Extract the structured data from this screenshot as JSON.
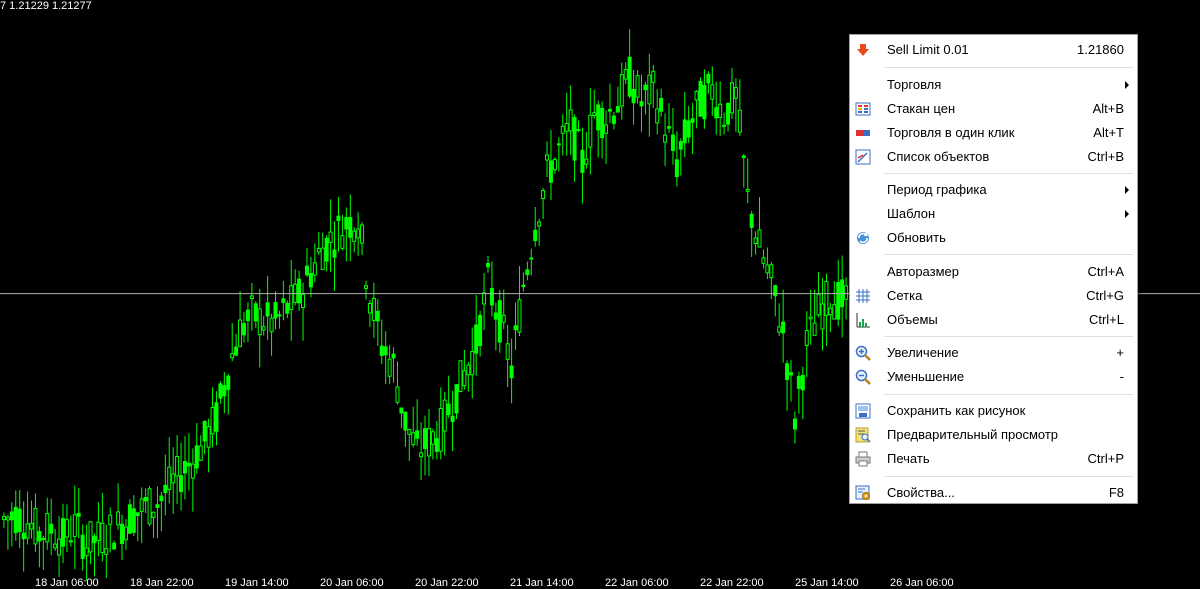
{
  "chart": {
    "price_line_label": "7 1.21229 1.21277",
    "x_ticks": [
      "18 Jan 06:00",
      "18 Jan 22:00",
      "19 Jan 14:00",
      "20 Jan 06:00",
      "20 Jan 22:00",
      "21 Jan 14:00",
      "22 Jan 06:00",
      "22 Jan 22:00",
      "25 Jan 14:00",
      "26 Jan 06:00"
    ],
    "colors": {
      "background": "#000000",
      "candle": "#00ff00",
      "hline": "#c0c0c0"
    }
  },
  "chart_data": {
    "type": "candlestick",
    "title": "",
    "xlabel": "",
    "ylabel": "",
    "price_top": 1.2288,
    "price_bottom": 1.2057,
    "categories": [
      "18 Jan 06:00",
      "18 Jan 22:00",
      "19 Jan 14:00",
      "20 Jan 06:00",
      "20 Jan 22:00",
      "21 Jan 14:00",
      "22 Jan 06:00",
      "22 Jan 22:00",
      "25 Jan 14:00",
      "26 Jan 06:00"
    ],
    "close_series": [
      1.2078,
      1.208,
      1.2077,
      1.2072,
      1.2074,
      1.207,
      1.2075,
      1.2068,
      1.207,
      1.2073,
      1.2076,
      1.208,
      1.2083,
      1.2085,
      1.2091,
      1.2097,
      1.2103,
      1.211,
      1.212,
      1.214,
      1.2156,
      1.2162,
      1.216,
      1.2159,
      1.2165,
      1.217,
      1.218,
      1.219,
      1.2195,
      1.22,
      1.2202,
      1.217,
      1.215,
      1.2141,
      1.2118,
      1.2106,
      1.211,
      1.2115,
      1.2127,
      1.2138,
      1.215,
      1.2175,
      1.216,
      1.214,
      1.2175,
      1.22,
      1.222,
      1.223,
      1.224,
      1.2225,
      1.2245,
      1.2244,
      1.225,
      1.226,
      1.225,
      1.2255,
      1.224,
      1.2225,
      1.224,
      1.225,
      1.2255,
      1.2245,
      1.2252,
      1.221,
      1.219,
      1.2175,
      1.2155,
      1.212,
      1.215,
      1.2163,
      1.217,
      1.2168
    ],
    "horizontal_line": 1.2171
  },
  "menu": {
    "items": [
      {
        "label": "Sell Limit 0.01",
        "shortcut": "1.21860",
        "icon": "sell-limit-arrow-icon"
      },
      {
        "label": "Торговля",
        "shortcut": "",
        "icon": ""
      },
      {
        "label": "Стакан цен",
        "shortcut": "Alt+B",
        "icon": "depth-of-market-icon"
      },
      {
        "label": "Торговля в один клик",
        "shortcut": "Alt+T",
        "icon": "one-click-trading-icon"
      },
      {
        "label": "Список объектов",
        "shortcut": "Ctrl+B",
        "icon": "objects-list-icon"
      },
      {
        "label": "Период графика",
        "shortcut": "",
        "icon": ""
      },
      {
        "label": "Шаблон",
        "shortcut": "",
        "icon": ""
      },
      {
        "label": "Обновить",
        "shortcut": "",
        "icon": "refresh-icon"
      },
      {
        "label": "Авторазмер",
        "shortcut": "Ctrl+A",
        "icon": ""
      },
      {
        "label": "Сетка",
        "shortcut": "Ctrl+G",
        "icon": "grid-icon"
      },
      {
        "label": "Объемы",
        "shortcut": "Ctrl+L",
        "icon": "volumes-icon"
      },
      {
        "label": "Увеличение",
        "shortcut": "+",
        "icon": "zoom-in-icon"
      },
      {
        "label": "Уменьшение",
        "shortcut": "-",
        "icon": "zoom-out-icon"
      },
      {
        "label": "Сохранить как рисунок",
        "shortcut": "",
        "icon": "save-picture-icon"
      },
      {
        "label": "Предварительный просмотр",
        "shortcut": "",
        "icon": "print-preview-icon"
      },
      {
        "label": "Печать",
        "shortcut": "Ctrl+P",
        "icon": "printer-icon"
      },
      {
        "label": "Свойства...",
        "shortcut": "F8",
        "icon": "properties-icon"
      }
    ]
  }
}
